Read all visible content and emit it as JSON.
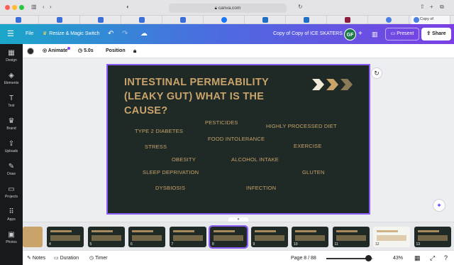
{
  "browser": {
    "url": "canva.com",
    "tabs": [
      {
        "label": "",
        "kind": "t-gen"
      },
      {
        "label": "",
        "kind": "t-gen"
      },
      {
        "label": "",
        "kind": "t-gen"
      },
      {
        "label": "",
        "kind": "t-gen"
      },
      {
        "label": "",
        "kind": "t-gen"
      },
      {
        "label": "",
        "kind": "t-fb"
      },
      {
        "label": "",
        "kind": "t-outlook"
      },
      {
        "label": "",
        "kind": "t-outlook"
      },
      {
        "label": "",
        "kind": "t-bar"
      },
      {
        "label": "",
        "kind": "t-ch"
      },
      {
        "label": "Copy of",
        "kind": "active"
      }
    ]
  },
  "header": {
    "file_label": "File",
    "resize_label": "Resize & Magic Switch",
    "doc_title": "Copy of Copy of ICE SKATERS",
    "avatar_initials": "GF",
    "present_label": "Present",
    "share_label": "Share"
  },
  "sidebar": {
    "items": [
      {
        "label": "Design",
        "icon": "design-icon",
        "glyph": "▦"
      },
      {
        "label": "Elements",
        "icon": "elements-icon",
        "glyph": "◈"
      },
      {
        "label": "Text",
        "icon": "text-icon",
        "glyph": "T"
      },
      {
        "label": "Brand",
        "icon": "brand-icon",
        "glyph": "♛"
      },
      {
        "label": "Uploads",
        "icon": "uploads-icon",
        "glyph": "⇪"
      },
      {
        "label": "Draw",
        "icon": "draw-icon",
        "glyph": "✎"
      },
      {
        "label": "Projects",
        "icon": "projects-icon",
        "glyph": "▭"
      },
      {
        "label": "Apps",
        "icon": "apps-icon",
        "glyph": "⠿"
      },
      {
        "label": "Photos",
        "icon": "photos-icon",
        "glyph": "▣"
      }
    ]
  },
  "toolbar": {
    "animate_label": "Animate",
    "duration_label": "5.0s",
    "position_label": "Position"
  },
  "slide": {
    "title": "INTESTINAL PERMEABILITY (LEAKY GUT) WHAT IS THE CAUSE?",
    "causes": [
      "PESTICIDES",
      "HIGHLY PROCESSED DIET",
      "TYPE 2 DIABETES",
      "FOOD INTOLERANCE",
      "STRESS",
      "EXERCISE",
      "OBESITY",
      "ALCOHOL INTAKE",
      "SLEEP DEPRIVATION",
      "GLUTEN",
      "DYSBIOSIS",
      "INFECTION"
    ],
    "colors": {
      "background": "#1f2a27",
      "accent": "#c9a36a"
    }
  },
  "filmstrip": {
    "pages": [
      {
        "num": "",
        "style": "tan"
      },
      {
        "num": "4",
        "style": "dark"
      },
      {
        "num": "5",
        "style": "dark"
      },
      {
        "num": "6",
        "style": "dark"
      },
      {
        "num": "7",
        "style": "dark"
      },
      {
        "num": "8",
        "style": "active"
      },
      {
        "num": "9",
        "style": "dark"
      },
      {
        "num": "10",
        "style": "dark"
      },
      {
        "num": "11",
        "style": "dark"
      },
      {
        "num": "12",
        "style": "light"
      },
      {
        "num": "13",
        "style": "dark"
      }
    ]
  },
  "bottombar": {
    "notes_label": "Notes",
    "duration_label": "Duration",
    "timer_label": "Timer",
    "page_label": "Page 8 / 88",
    "zoom_label": "43%",
    "zoom_fraction": 0.9
  }
}
